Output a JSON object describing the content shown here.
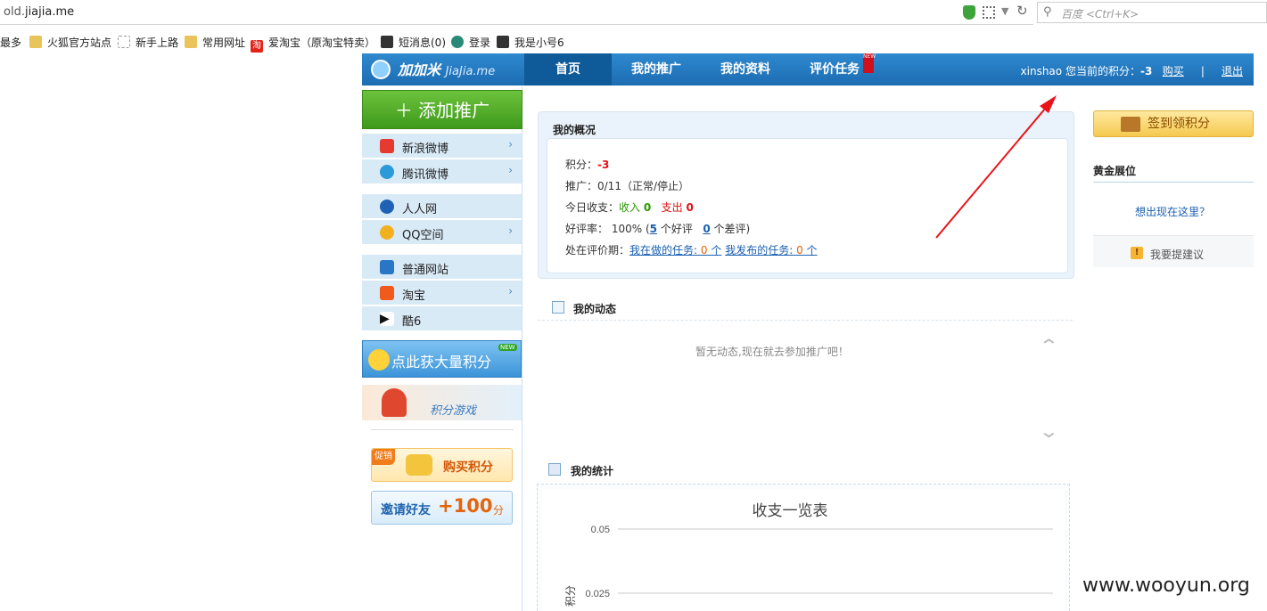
{
  "browser": {
    "url_prefix": "old.",
    "url_domain": "jiajia.me",
    "search_placeholder": "百度 <Ctrl+K>",
    "bookmarks": [
      "最多",
      "火狐官方站点",
      "新手上路",
      "常用网址",
      "爱淘宝（原淘宝特卖）",
      "短消息(0)",
      "登录",
      "我是小号6"
    ]
  },
  "header": {
    "logo_cn": "加加米",
    "logo_en": "JiaJia.me",
    "nav": [
      "首页",
      "我的推广",
      "我的资料",
      "评价任务"
    ],
    "new_flag": "NEW",
    "username": "xinshao",
    "points_label": "您当前的积分：",
    "points_value": "-3",
    "buy_link": "购买",
    "sep": "|",
    "logout_link": "退出"
  },
  "sidebar": {
    "add_button": "添加推广",
    "items": [
      {
        "label": "新浪微博",
        "arrow": true
      },
      {
        "label": "腾讯微博",
        "arrow": true
      },
      {
        "label": "人人网",
        "arrow": false
      },
      {
        "label": "QQ空间",
        "arrow": true
      },
      {
        "label": "普通网站",
        "arrow": false
      },
      {
        "label": "淘宝",
        "arrow": true
      },
      {
        "label": "酷6",
        "arrow": false
      }
    ],
    "promo_points": "点此获大量积分",
    "promo_new": "NEW",
    "promo_game": "积分游戏",
    "buy_points": "购买积分",
    "promo_tag": "促销",
    "invite_label": "邀请好友",
    "invite_bonus": "+100",
    "invite_unit": "分"
  },
  "overview": {
    "title": "我的概况",
    "points_label": "积分：",
    "points_value": "-3",
    "promo_line": "推广：0/11（正常/停止）",
    "today_label": "今日收支：",
    "income_label": "收入",
    "income_value": "0",
    "expense_label": "支出",
    "expense_value": "0",
    "rating_label": "好评率：",
    "rating_value": "100%",
    "good_count": "5",
    "good_label": "个好评",
    "bad_count": "0",
    "bad_label": "个差评",
    "review_label": "处在评价期：",
    "doing_link": "我在做的任务:",
    "doing_count": "0",
    "published_link": "我发布的任务:",
    "published_count": "0",
    "unit": "个"
  },
  "activity": {
    "title": "我的动态",
    "empty_text": "暂无动态,现在就去参加推广吧！"
  },
  "stats": {
    "title": "我的统计"
  },
  "chart_data": {
    "type": "line",
    "title": "收支一览表",
    "ylabel": "积分",
    "yticks": [
      "0.05",
      "0.025"
    ],
    "series": []
  },
  "right": {
    "sign_button": "签到领积分",
    "gold_title": "黄金展位",
    "want_here": "想出现在这里？",
    "suggest": "我要提建议"
  },
  "watermark": "www.wooyun.org"
}
